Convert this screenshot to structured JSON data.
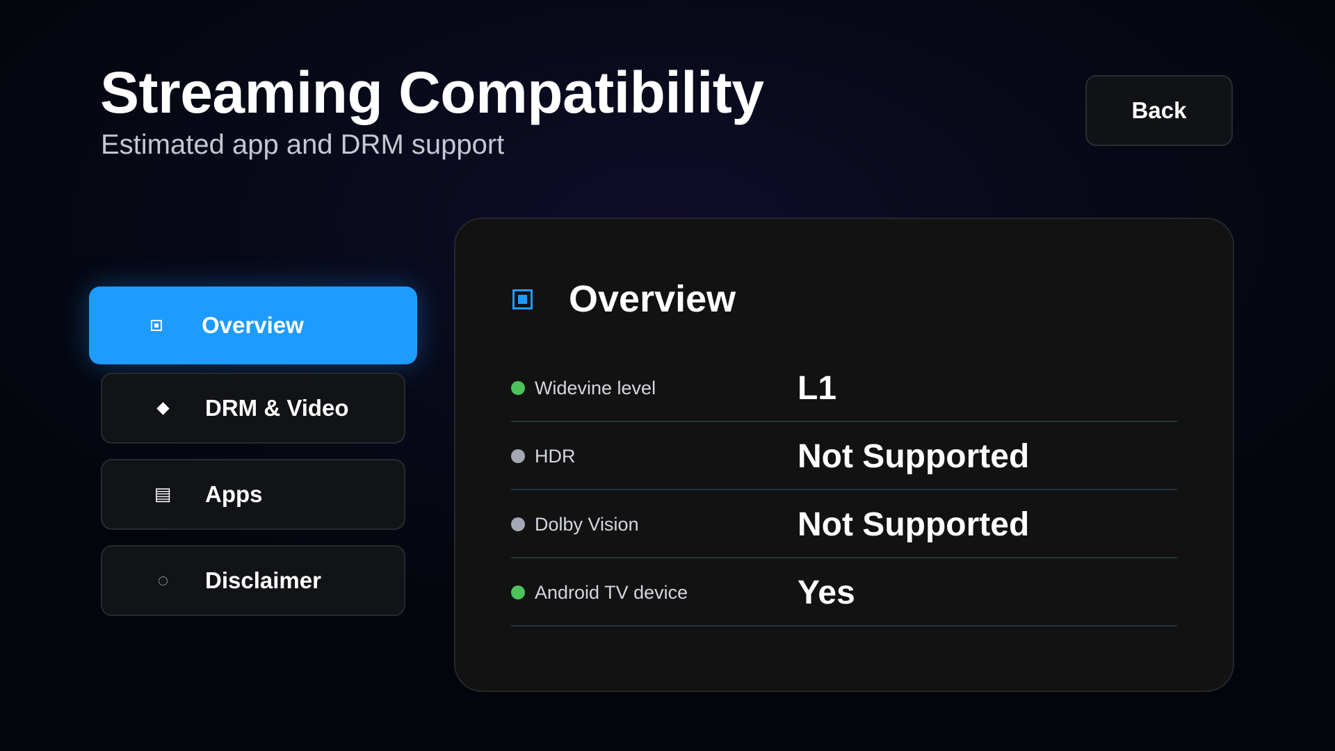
{
  "header": {
    "title": "Streaming Compatibility",
    "subtitle": "Estimated app and DRM support",
    "back_label": "Back"
  },
  "nav": {
    "items": [
      {
        "label": "Overview",
        "icon": "square-icon",
        "active": true
      },
      {
        "label": "DRM & Video",
        "icon": "diamond-icon",
        "active": false
      },
      {
        "label": "Apps",
        "icon": "document-icon",
        "active": false
      },
      {
        "label": "Disclaimer",
        "icon": "circle-icon",
        "active": false
      }
    ]
  },
  "panel": {
    "title": "Overview",
    "icon": "square-icon",
    "rows": [
      {
        "label": "Widevine level",
        "value": "L1",
        "status": "green"
      },
      {
        "label": "HDR",
        "value": "Not Supported",
        "status": "gray"
      },
      {
        "label": "Dolby Vision",
        "value": "Not Supported",
        "status": "gray"
      },
      {
        "label": "Android TV device",
        "value": "Yes",
        "status": "green"
      }
    ]
  },
  "colors": {
    "accent": "#1e9bff",
    "status_green": "#4cc25a",
    "status_gray": "#a4a8b4",
    "panel_bg": "#121212"
  }
}
